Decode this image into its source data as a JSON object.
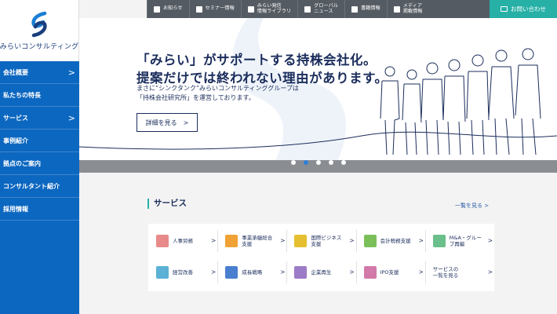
{
  "logo": {
    "text": "みらいコンサルティング"
  },
  "sidebar": {
    "items": [
      {
        "label": "会社概要",
        "chevron": ">"
      },
      {
        "label": "私たちの特長",
        "chevron": ""
      },
      {
        "label": "サービス",
        "chevron": ">"
      },
      {
        "label": "事例紹介",
        "chevron": ""
      },
      {
        "label": "拠点のご案内",
        "chevron": ""
      },
      {
        "label": "コンサルタント紹介",
        "chevron": ""
      },
      {
        "label": "採用情報",
        "chevron": ""
      }
    ]
  },
  "topbar": {
    "items": [
      {
        "label": "お知らせ",
        "icon": "notice-icon"
      },
      {
        "label": "セミナー情報",
        "icon": "seminar-icon"
      },
      {
        "label": "みらい発信\n情報ライブラリ",
        "icon": "pen-icon"
      },
      {
        "label": "グローバル\nニュース",
        "icon": "globe-icon"
      },
      {
        "label": "書籍情報",
        "icon": "book-icon"
      },
      {
        "label": "メディア\n掲載情報",
        "icon": "megaphone-icon"
      }
    ],
    "contact": "お問い合わせ"
  },
  "hero": {
    "title_line1": "「みらい」がサポートする持株会社化。",
    "title_line2": "提案だけでは終われない理由があります。",
    "sub_line1": "まさに”シンクタンク”みらいコンサルティンググループは",
    "sub_line2": "「持株会社研究所」を運営しております。",
    "button": "詳細を見る",
    "button_chevron": ">",
    "slides": 5,
    "active_slide": 2
  },
  "services": {
    "heading": "サービス",
    "more": "一覧を見る >",
    "arrow": ">",
    "items": [
      {
        "label": "人事労務",
        "icon": "people-icon",
        "color": "#e88a8a"
      },
      {
        "label": "事業承継総合\n支援",
        "icon": "building-icon",
        "color": "#f0a236"
      },
      {
        "label": "国際ビジネス\n支援",
        "icon": "globe-money-icon",
        "color": "#e5bf2f"
      },
      {
        "label": "会計税務支援",
        "icon": "calculator-icon",
        "color": "#7bbf5a"
      },
      {
        "label": "M&A・グルー\nプ再編",
        "icon": "handshake-icon",
        "color": "#6abf8a"
      },
      {
        "label": "経営改善",
        "icon": "document-icon",
        "color": "#5bb1d6"
      },
      {
        "label": "成長戦略",
        "icon": "growth-chart-icon",
        "color": "#4a7fd0"
      },
      {
        "label": "企業再生",
        "icon": "shopping-cart-icon",
        "color": "#9c7bc7"
      },
      {
        "label": "IPO支援",
        "icon": "ipo-icon",
        "color": "#d27aa9"
      },
      {
        "label": "サービスの\n一覧を見る",
        "icon": "",
        "color": ""
      }
    ]
  }
}
